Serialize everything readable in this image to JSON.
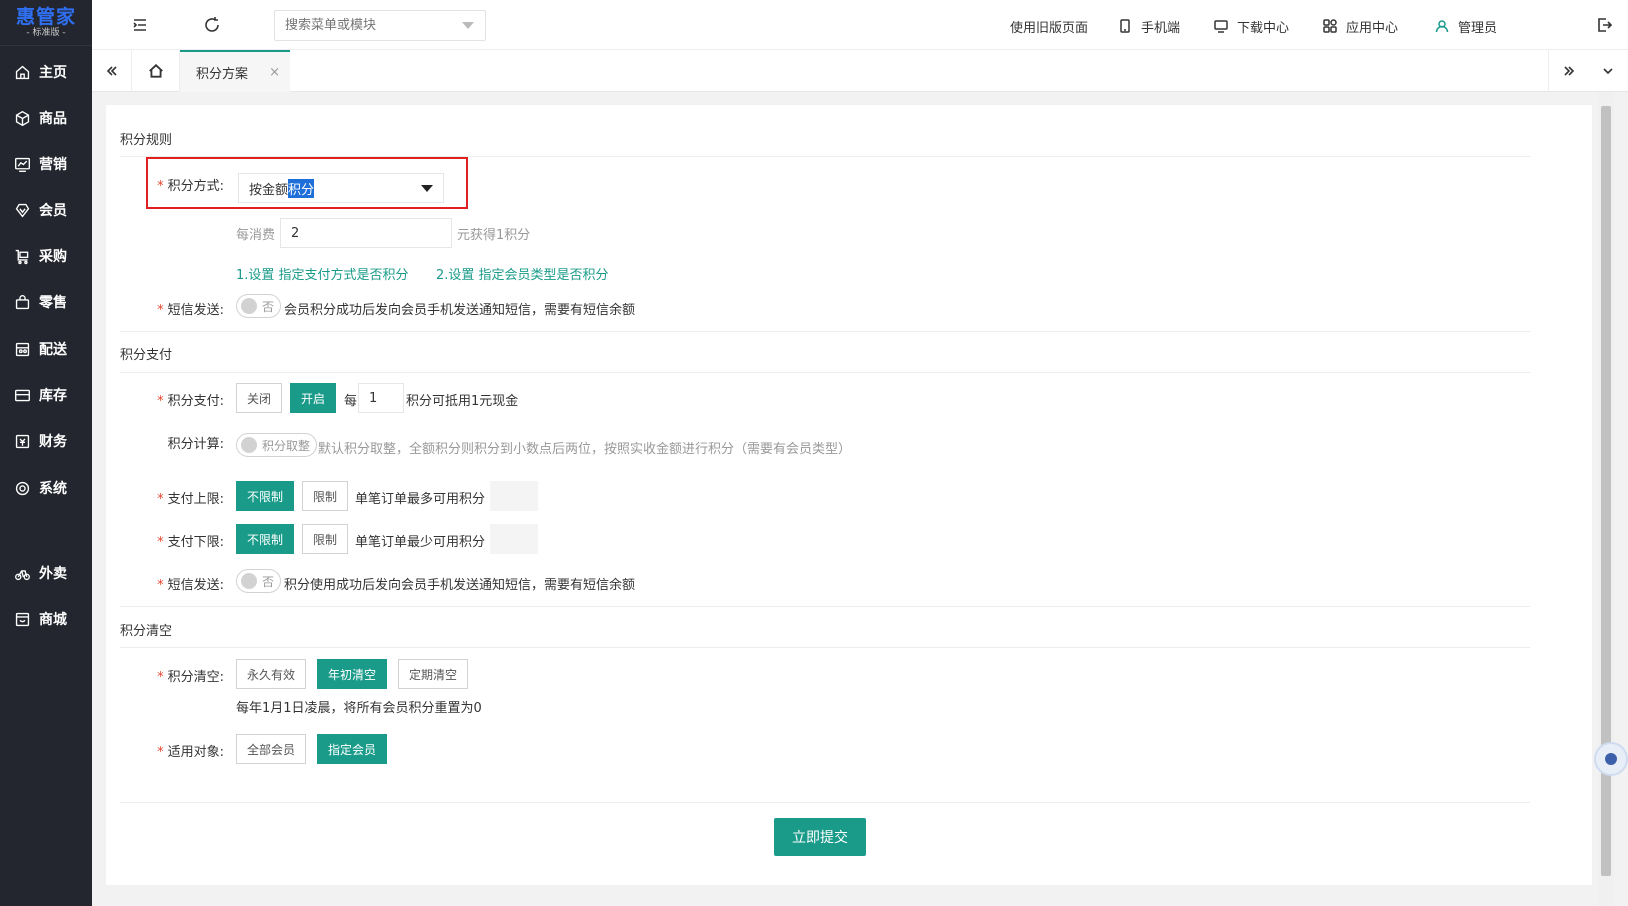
{
  "brand": {
    "name": "惠管家",
    "edition": "- 标准版 -"
  },
  "sidebar": {
    "items": [
      {
        "label": "主页",
        "icon": "home-icon"
      },
      {
        "label": "商品",
        "icon": "box-icon"
      },
      {
        "label": "营销",
        "icon": "chart-icon"
      },
      {
        "label": "会员",
        "icon": "diamond-icon"
      },
      {
        "label": "采购",
        "icon": "cart-icon"
      },
      {
        "label": "零售",
        "icon": "bag-icon"
      },
      {
        "label": "配送",
        "icon": "store-icon"
      },
      {
        "label": "库存",
        "icon": "inbox-icon"
      },
      {
        "label": "财务",
        "icon": "finance-icon"
      },
      {
        "label": "系统",
        "icon": "settings-icon"
      },
      {
        "label": "外卖",
        "icon": "bike-icon"
      },
      {
        "label": "商城",
        "icon": "shop-icon"
      }
    ]
  },
  "topbar": {
    "search_placeholder": "搜索菜单或模块",
    "links": {
      "old_page": "使用旧版页面",
      "mobile": "手机端",
      "download": "下载中心",
      "apps": "应用中心",
      "user": "管理员"
    }
  },
  "tabs": {
    "active": "积分方案",
    "close": "×"
  },
  "form": {
    "rules": {
      "title": "积分规则",
      "method_label": "积分方式:",
      "method_value_prefix": "按金额",
      "method_value_highlight": "积分",
      "per_spend_label": "每消费",
      "per_spend_value": "2",
      "per_spend_suffix": "元获得1积分",
      "link1": "1.设置 指定支付方式是否积分",
      "link2": "2.设置 指定会员类型是否积分",
      "sms_label": "短信发送:",
      "sms_switch": "否",
      "sms_desc": "会员积分成功后发向会员手机发送通知短信，需要有短信余额"
    },
    "payment": {
      "title": "积分支付",
      "pay_label": "积分支付:",
      "off": "关闭",
      "on": "开启",
      "every": "每",
      "every_value": "1",
      "every_suffix": "积分可抵用1元现金",
      "calc_label": "积分计算:",
      "calc_switch": "积分取整",
      "calc_desc": "默认积分取整，全额积分则积分到小数点后两位，按照实收金额进行积分（需要有会员类型）",
      "upper_label": "支付上限:",
      "lower_label": "支付下限:",
      "unlimited": "不限制",
      "limited": "限制",
      "upper_desc": "单笔订单最多可用积分",
      "lower_desc": "单笔订单最少可用积分",
      "sms_label": "短信发送:",
      "sms_switch": "否",
      "sms_desc": "积分使用成功后发向会员手机发送通知短信，需要有短信余额"
    },
    "clear": {
      "title": "积分清空",
      "clear_label": "积分清空:",
      "forever": "永久有效",
      "year_start": "年初清空",
      "periodic": "定期清空",
      "clear_desc": "每年1月1日凌晨，将所有会员积分重置为0",
      "target_label": "适用对象:",
      "all_members": "全部会员",
      "specific_members": "指定会员"
    },
    "submit": "立即提交"
  },
  "colors": {
    "accent": "#1a9b8a",
    "sidebar_bg": "#23262e",
    "highlight_box": "#e02020",
    "required": "#e3452f"
  }
}
